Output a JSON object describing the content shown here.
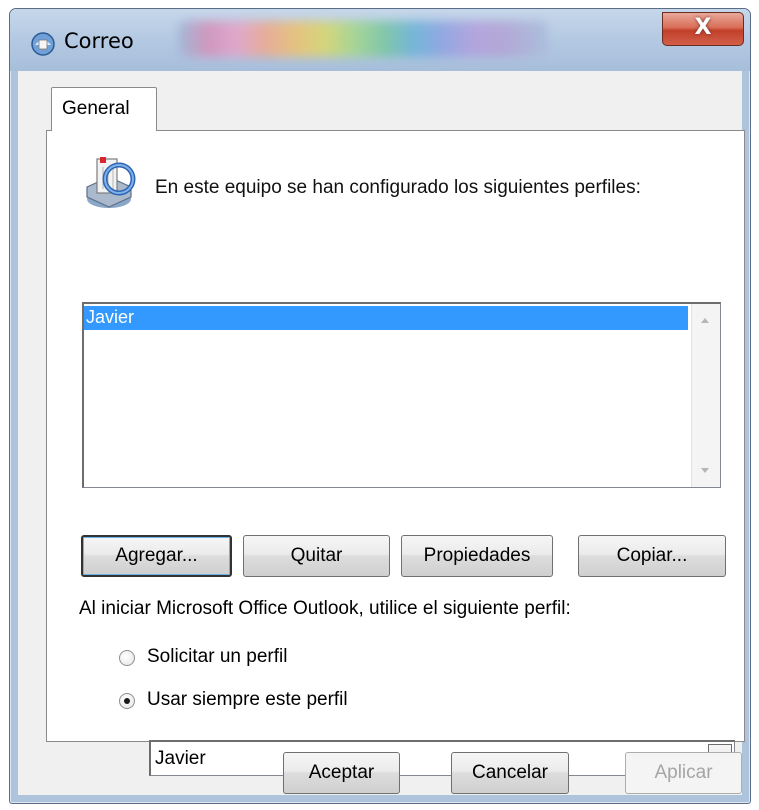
{
  "window": {
    "title": "Correo",
    "close_label": "X"
  },
  "tabs": [
    {
      "label": "General",
      "selected": true
    }
  ],
  "general": {
    "intro_text": "En este equipo se han configurado los siguientes perfiles:",
    "profiles": [
      {
        "name": "Javier",
        "selected": true
      }
    ],
    "buttons": {
      "add": "Agregar...",
      "remove": "Quitar",
      "properties": "Propiedades",
      "copy": "Copiar..."
    },
    "startup_label": "Al iniciar Microsoft Office Outlook, utilice el siguiente perfil:",
    "options": {
      "prompt_label": "Solicitar un perfil",
      "prompt_checked": false,
      "always_label": "Usar siempre este perfil",
      "always_checked": true
    },
    "profile_select_value": "Javier"
  },
  "footer": {
    "ok": "Aceptar",
    "cancel": "Cancelar",
    "apply": "Aplicar",
    "apply_disabled": true
  },
  "colors": {
    "selection": "#3399ff",
    "window_frame": "#aec3dc",
    "close_button": "#c9452f"
  },
  "icons": [
    "mail-profile-icon",
    "mail-profiles-icon",
    "chevron-down-icon",
    "scroll-up-icon",
    "scroll-down-icon"
  ]
}
